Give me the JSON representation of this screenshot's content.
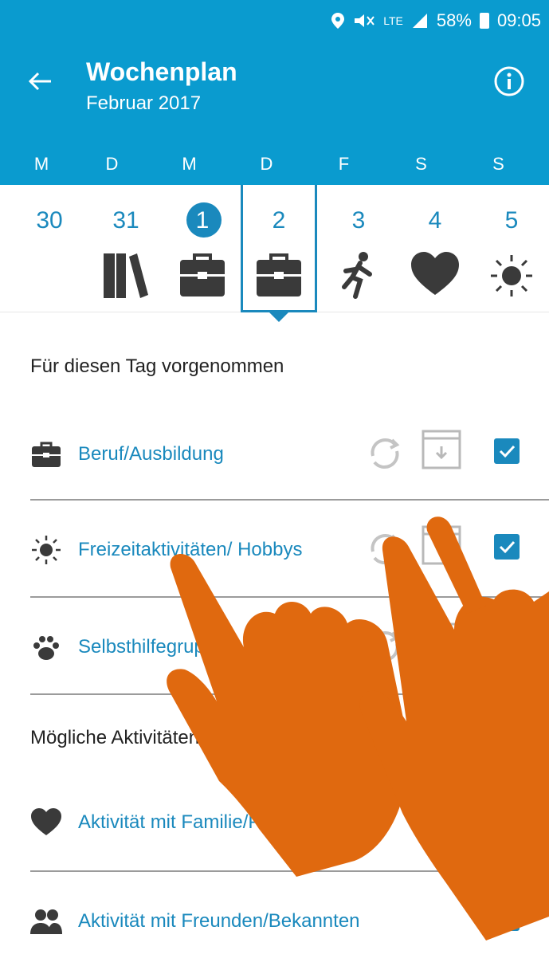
{
  "status_bar": {
    "lte": "LTE",
    "battery": "58%",
    "time": "09:05"
  },
  "header": {
    "title": "Wochenplan",
    "subtitle": "Februar 2017"
  },
  "week": {
    "weekday_letters": [
      "M",
      "D",
      "M",
      "D",
      "F",
      "S",
      "S"
    ],
    "dates": [
      "30",
      "31",
      "1",
      "2",
      "3",
      "4",
      "5"
    ],
    "day_icons": [
      "none",
      "books-icon",
      "briefcase-icon",
      "briefcase-icon",
      "running-person-icon",
      "heart-icon",
      "sun-icon"
    ],
    "today_index": 2,
    "selected_index": 3
  },
  "planned": {
    "header": "Für diesen Tag vorgenommen",
    "items": [
      {
        "label": "Beruf/Ausbildung",
        "icon": "briefcase-icon",
        "checked": true
      },
      {
        "label": "Freizeitaktivitäten/ Hobbys",
        "icon": "sun-icon",
        "checked": true
      },
      {
        "label": "Selbsthilfegruppe",
        "icon": "paw-icon",
        "checked": true
      }
    ]
  },
  "possible": {
    "header": "Mögliche Aktivitäten",
    "items": [
      {
        "label": "Aktivität mit Familie/PartnerIn",
        "icon": "heart-icon",
        "checked": false
      },
      {
        "label": "Aktivität mit Freunden/Bekannten",
        "icon": "people-icon",
        "checked": false
      }
    ]
  },
  "colors": {
    "primary": "#0a9bcf",
    "accent": "#1a89bd",
    "hand": "#e0690f"
  }
}
